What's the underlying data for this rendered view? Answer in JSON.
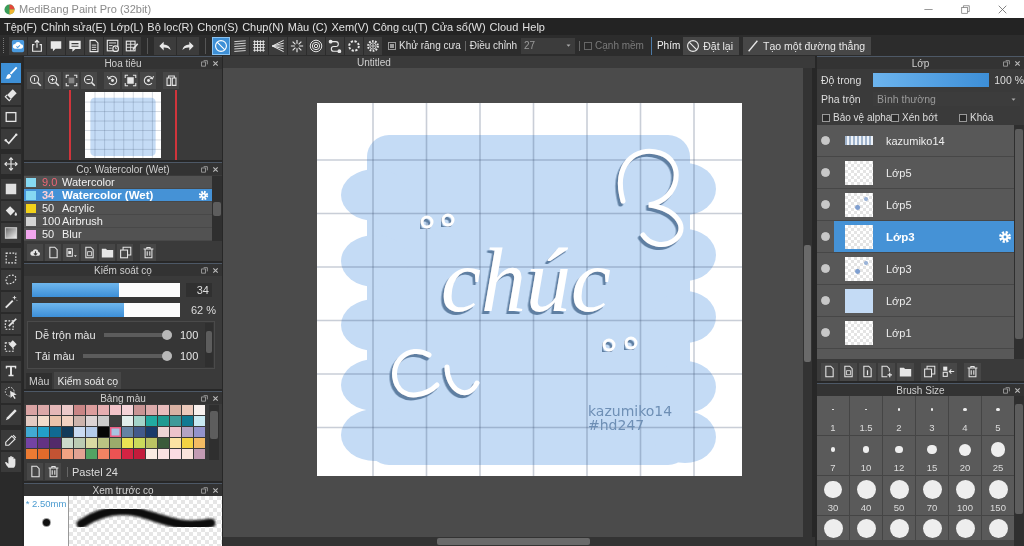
{
  "window": {
    "title": "MediBang Paint Pro (32bit)"
  },
  "menu": [
    "Tệp(F)",
    "Chỉnh sửa(E)",
    "Lớp(L)",
    "Bộ lọc(R)",
    "Chọn(S)",
    "Chụp(N)",
    "Màu (C)",
    "Xem(V)",
    "Công cụ(T)",
    "Cửa sổ(W)",
    "Cloud",
    "Help"
  ],
  "toolbar": {
    "ruler_tools": [
      {
        "selected": true
      },
      {
        "selected": false
      },
      {
        "selected": false
      },
      {
        "selected": false
      },
      {
        "selected": false
      },
      {
        "selected": false
      },
      {
        "selected": false
      },
      {
        "selected": false
      },
      {
        "selected": false
      }
    ],
    "antialias": {
      "label": "Khử răng cưa",
      "checked": true
    },
    "adjust": {
      "label": "Điều chỉnh",
      "value": "27"
    },
    "soft_edge": {
      "label": "Cạnh mềm",
      "checked": false,
      "disabled": true
    },
    "key_label": "Phím",
    "reset_button": "Đặt lại",
    "line_button": "Tạo một đường thẳng"
  },
  "tools": [
    {
      "selected": true
    },
    {
      "selected": false
    },
    {
      "selected": false
    },
    {
      "selected": false
    },
    {
      "selected": false
    },
    {
      "selected": false
    },
    {
      "selected": false
    },
    {
      "selected": false
    },
    {
      "selected": false
    },
    {
      "selected": false
    },
    {
      "selected": false
    },
    {
      "selected": false
    },
    {
      "selected": false
    },
    {
      "selected": false
    },
    {
      "selected": false
    },
    {
      "selected": false
    },
    {
      "selected": false
    },
    {
      "selected": false
    }
  ],
  "navigator": {
    "title": "Hoa tiêu"
  },
  "brush_panel": {
    "title": "Cọ: Watercolor (Wet)",
    "brushes": [
      {
        "size": "9.0",
        "name": "Watercolor",
        "color": "#86d9f2",
        "highlighted": true,
        "selected": false
      },
      {
        "size": "34",
        "name": "Watercolor (Wet)",
        "color": "#86d9f2",
        "highlighted": true,
        "selected": true
      },
      {
        "size": "50",
        "name": "Acrylic",
        "color": "#f2d21a",
        "highlighted": false,
        "selected": false
      },
      {
        "size": "100",
        "name": "Airbrush",
        "color": "#d4d4d4",
        "highlighted": false,
        "selected": false
      },
      {
        "size": "50",
        "name": "Blur",
        "color": "#f2a6ee",
        "highlighted": false,
        "selected": false
      }
    ]
  },
  "brush_control": {
    "title": "Kiểm soát cọ",
    "size": {
      "level": 0.59,
      "value": "34"
    },
    "opacity": {
      "level": 0.62,
      "value": "62 %"
    },
    "sliders": [
      {
        "label": "Dễ trộn màu",
        "level": 1,
        "value": "100"
      },
      {
        "label": "Tải màu",
        "level": 1,
        "value": "100"
      }
    ],
    "tabs": [
      {
        "label": "Màu",
        "selected": false
      },
      {
        "label": "Kiểm soát cọ",
        "selected": true
      }
    ]
  },
  "palette": {
    "title": "Bảng màu",
    "swatches": [
      {
        "color": "#d9a3a3",
        "selected": false
      },
      {
        "color": "#dba8a8",
        "selected": false
      },
      {
        "color": "#e4b7b7",
        "selected": false
      },
      {
        "color": "#ecc9c9",
        "selected": false
      },
      {
        "color": "#c98585",
        "selected": false
      },
      {
        "color": "#dc9d9d",
        "selected": false
      },
      {
        "color": "#e6aeb1",
        "selected": false
      },
      {
        "color": "#f2c2c8",
        "selected": false
      },
      {
        "color": "#f5d3d8",
        "selected": false
      },
      {
        "color": "#c99494",
        "selected": false
      },
      {
        "color": "#dbaaaa",
        "selected": false
      },
      {
        "color": "#e8bcbc",
        "selected": false
      },
      {
        "color": "#d9b1a3",
        "selected": false
      },
      {
        "color": "#ecc9bb",
        "selected": false
      },
      {
        "color": "#f8f1ee",
        "selected": false
      },
      {
        "color": "#e3cbc3",
        "selected": false
      },
      {
        "color": "#f2dccb",
        "selected": false
      },
      {
        "color": "#eac3ab",
        "selected": false
      },
      {
        "color": "#f2d2c2",
        "selected": false
      },
      {
        "color": "#cdb4ac",
        "selected": false
      },
      {
        "color": "#dcd4d4",
        "selected": false
      },
      {
        "color": "#cbcbcb",
        "selected": false
      },
      {
        "color": "#3f3f3f",
        "selected": false
      },
      {
        "color": "#e2eeec",
        "selected": false
      },
      {
        "color": "#a3d3c9",
        "selected": false
      },
      {
        "color": "#22aaa1",
        "selected": false
      },
      {
        "color": "#1f9a91",
        "selected": false
      },
      {
        "color": "#3f9a99",
        "selected": false
      },
      {
        "color": "#117a92",
        "selected": false
      },
      {
        "color": "#c8e9f2",
        "selected": false
      },
      {
        "color": "#41aad3",
        "selected": false
      },
      {
        "color": "#22a1c9",
        "selected": false
      },
      {
        "color": "#106a92",
        "selected": false
      },
      {
        "color": "#113a5a",
        "selected": false
      },
      {
        "color": "#c9dbf2",
        "selected": false
      },
      {
        "color": "#b3cbea",
        "selected": false
      },
      {
        "color": "#050505",
        "selected": false
      },
      {
        "color": "#a9c3e2",
        "selected": true
      },
      {
        "color": "#6583a3",
        "selected": false
      },
      {
        "color": "#42598a",
        "selected": false
      },
      {
        "color": "#1a3a6a",
        "selected": false
      },
      {
        "color": "#ecd4d4",
        "selected": false
      },
      {
        "color": "#ecc3cb",
        "selected": false
      },
      {
        "color": "#b3a3c3",
        "selected": false
      },
      {
        "color": "#9393cb",
        "selected": false
      },
      {
        "color": "#7343a3",
        "selected": false
      },
      {
        "color": "#633383",
        "selected": false
      },
      {
        "color": "#532a6a",
        "selected": false
      },
      {
        "color": "#cbdacb",
        "selected": false
      },
      {
        "color": "#bbcbb3",
        "selected": false
      },
      {
        "color": "#dadaa3",
        "selected": false
      },
      {
        "color": "#bbc383",
        "selected": false
      },
      {
        "color": "#9bab6b",
        "selected": false
      },
      {
        "color": "#ebe353",
        "selected": false
      },
      {
        "color": "#cbda5b",
        "selected": false
      },
      {
        "color": "#bbc363",
        "selected": false
      },
      {
        "color": "#3b5b3b",
        "selected": false
      },
      {
        "color": "#fbe3a3",
        "selected": false
      },
      {
        "color": "#f3d343",
        "selected": false
      },
      {
        "color": "#f3bb63",
        "selected": false
      },
      {
        "color": "#eb7b33",
        "selected": false
      },
      {
        "color": "#e36b2b",
        "selected": false
      },
      {
        "color": "#c35333",
        "selected": false
      },
      {
        "color": "#f3a383",
        "selected": false
      },
      {
        "color": "#e3a393",
        "selected": false
      },
      {
        "color": "#53a363",
        "selected": false
      },
      {
        "color": "#f38363",
        "selected": false
      },
      {
        "color": "#eb5353",
        "selected": false
      },
      {
        "color": "#d32343",
        "selected": false
      },
      {
        "color": "#c31b3b",
        "selected": false
      },
      {
        "color": "#fbebe3",
        "selected": false
      },
      {
        "color": "#fbe3e3",
        "selected": false
      },
      {
        "color": "#fbdbe3",
        "selected": false
      },
      {
        "color": "#fbe3db",
        "selected": false
      },
      {
        "color": "#c39bb3",
        "selected": false
      }
    ],
    "name": "Pastel 24"
  },
  "brush_preview": {
    "title": "Xem trước cọ",
    "size": "* 2.50mm"
  },
  "canvas": {
    "title": "Untitled",
    "lettering": "chúc",
    "signature": [
      "kazumiko14",
      "#hd247"
    ]
  },
  "layers_panel": {
    "title": "Lớp",
    "opacity": {
      "label": "Độ trong",
      "level": 1,
      "value": "100 %"
    },
    "blend": {
      "label": "Pha trộn",
      "value": "Bình thường"
    },
    "options": [
      {
        "label": "Bảo vệ alpha",
        "checked": false
      },
      {
        "label": "Xén bớt",
        "checked": false
      },
      {
        "label": "Khóa",
        "checked": false
      }
    ],
    "layers": [
      {
        "name": "kazumiko14",
        "kind": "strip",
        "visible": true,
        "selected": false
      },
      {
        "name": "Lớp5",
        "kind": "blank",
        "visible": true,
        "selected": false
      },
      {
        "name": "Lớp5",
        "kind": "sketch",
        "visible": true,
        "selected": false
      },
      {
        "name": "Lớp3",
        "kind": "blank",
        "visible": true,
        "selected": true
      },
      {
        "name": "Lớp3",
        "kind": "sketch",
        "visible": true,
        "selected": false
      },
      {
        "name": "Lớp2",
        "kind": "fill",
        "visible": true,
        "selected": false
      },
      {
        "name": "Lớp1",
        "kind": "blank",
        "visible": true,
        "selected": false
      }
    ]
  },
  "brush_size": {
    "title": "Brush Size",
    "sizes": [
      "1",
      "1.5",
      "2",
      "3",
      "4",
      "5",
      "7",
      "10",
      "12",
      "15",
      "20",
      "25",
      "30",
      "40",
      "50",
      "70",
      "100",
      "150"
    ]
  }
}
